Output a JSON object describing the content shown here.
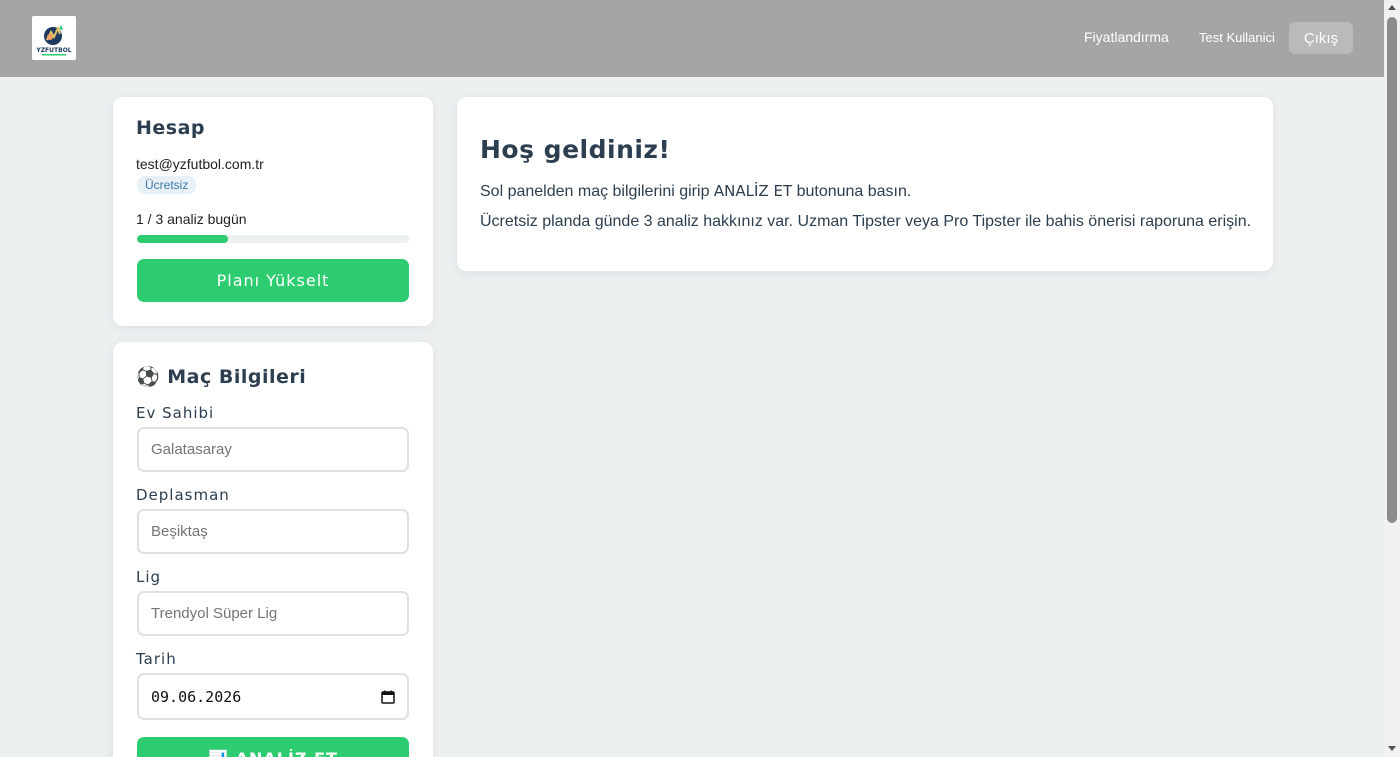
{
  "navbar": {
    "logo_text": "YZFUTBOL",
    "pricing_label": "Fiyatlandırma",
    "user_name": "Test Kullanici",
    "logout_label": "Çıkış"
  },
  "account": {
    "title": "Hesap",
    "email": "test@yzfutbol.com.tr",
    "plan": "Ücretsiz",
    "usage_text": "1 / 3 analiz bugün",
    "usage_fraction": 0.333,
    "upgrade_label": "Planı Yükselt"
  },
  "match": {
    "title": "⚽ Maç Bilgileri",
    "home_label": "Ev Sahibi",
    "home_placeholder": "Galatasaray",
    "away_label": "Deplasman",
    "away_placeholder": "Beşiktaş",
    "league_label": "Lig",
    "league_placeholder": "Trendyol Süper Lig",
    "date_label": "Tarih",
    "date_value": "09.06.2026",
    "analyze_label": "📊 ANALİZ ET"
  },
  "welcome": {
    "title": "Hoş geldiniz!",
    "line1_prefix": "Sol panelden maç bilgilerini girip ",
    "line1_button_ref": "ANALİZ ET",
    "line1_suffix": " butonuna basın.",
    "line2": "Ücretsiz planda günde 3 analiz hakkınız var. Uzman Tipster veya Pro Tipster ile bahis önerisi raporuna erişin."
  },
  "colors": {
    "accent_green": "#2ecc71",
    "navbar_bg": "#a4a5a7",
    "page_bg": "#ecf0f1",
    "text_dark": "#2c3e50"
  },
  "icons": {
    "logo": "yzfutbol-logo",
    "calendar": "calendar-icon"
  }
}
